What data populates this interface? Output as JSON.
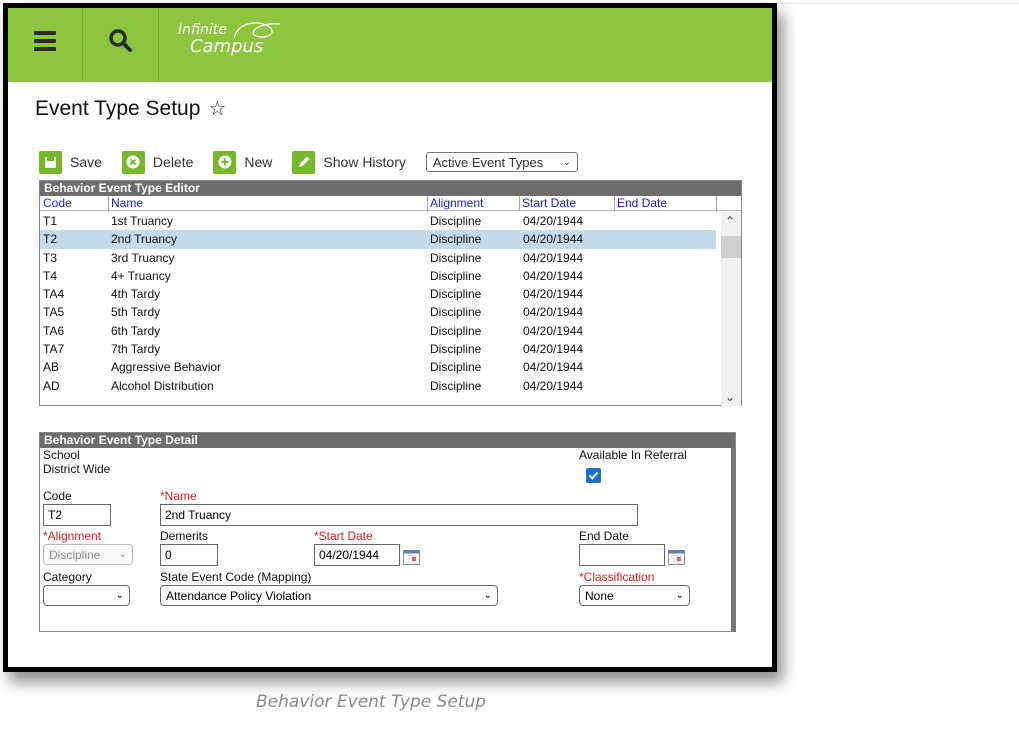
{
  "app": {
    "logo_line1": "Infinite",
    "logo_line2": "Campus",
    "page_title": "Event Type Setup"
  },
  "toolbar": {
    "save_label": "Save",
    "delete_label": "Delete",
    "new_label": "New",
    "history_label": "Show History",
    "filter_selected": "Active Event Types"
  },
  "editor": {
    "title": "Behavior Event Type Editor",
    "columns": [
      "Code",
      "Name",
      "Alignment",
      "Start Date",
      "End Date"
    ],
    "rows": [
      {
        "code": "T1",
        "name": "1st Truancy",
        "alignment": "Discipline",
        "start": "04/20/1944",
        "end": ""
      },
      {
        "code": "T2",
        "name": "2nd Truancy",
        "alignment": "Discipline",
        "start": "04/20/1944",
        "end": ""
      },
      {
        "code": "T3",
        "name": "3rd Truancy",
        "alignment": "Discipline",
        "start": "04/20/1944",
        "end": ""
      },
      {
        "code": "T4",
        "name": "4+ Truancy",
        "alignment": "Discipline",
        "start": "04/20/1944",
        "end": ""
      },
      {
        "code": "TA4",
        "name": "4th Tardy",
        "alignment": "Discipline",
        "start": "04/20/1944",
        "end": ""
      },
      {
        "code": "TA5",
        "name": "5th Tardy",
        "alignment": "Discipline",
        "start": "04/20/1944",
        "end": ""
      },
      {
        "code": "TA6",
        "name": "6th Tardy",
        "alignment": "Discipline",
        "start": "04/20/1944",
        "end": ""
      },
      {
        "code": "TA7",
        "name": "7th Tardy",
        "alignment": "Discipline",
        "start": "04/20/1944",
        "end": ""
      },
      {
        "code": "AB",
        "name": "Aggressive Behavior",
        "alignment": "Discipline",
        "start": "04/20/1944",
        "end": ""
      },
      {
        "code": "AD",
        "name": "Alcohol Distribution",
        "alignment": "Discipline",
        "start": "04/20/1944",
        "end": ""
      }
    ],
    "selected_index": 1
  },
  "detail": {
    "title": "Behavior Event Type Detail",
    "school_label": "School",
    "school_value": "District Wide",
    "available_label": "Available In Referral",
    "available_checked": true,
    "code_label": "Code",
    "code_value": "T2",
    "name_label": "*Name",
    "name_value": "2nd Truancy",
    "alignment_label": "*Alignment",
    "alignment_value": "Discipline",
    "demerits_label": "Demerits",
    "demerits_value": "0",
    "start_label": "*Start Date",
    "start_value": "04/20/1944",
    "end_label": "End Date",
    "end_value": "",
    "category_label": "Category",
    "category_value": "",
    "state_code_label": "State Event Code (Mapping)",
    "state_code_value": "Attendance Policy Violation",
    "classification_label": "*Classification",
    "classification_value": "None"
  },
  "caption": "Behavior Event Type Setup",
  "colors": {
    "appbar": "#8cc63f",
    "button_green": "#76b82a",
    "panel_header": "#6d6d6d",
    "selected_row": "#c5dbec",
    "required_red": "#e01b1b",
    "column_link": "#1a22d6",
    "checkbox_blue": "#1c6fd1"
  },
  "icons": [
    "menu-icon",
    "search-icon",
    "star-icon",
    "save-icon",
    "delete-icon",
    "new-icon",
    "pencil-icon",
    "calendar-icon",
    "check-icon"
  ]
}
